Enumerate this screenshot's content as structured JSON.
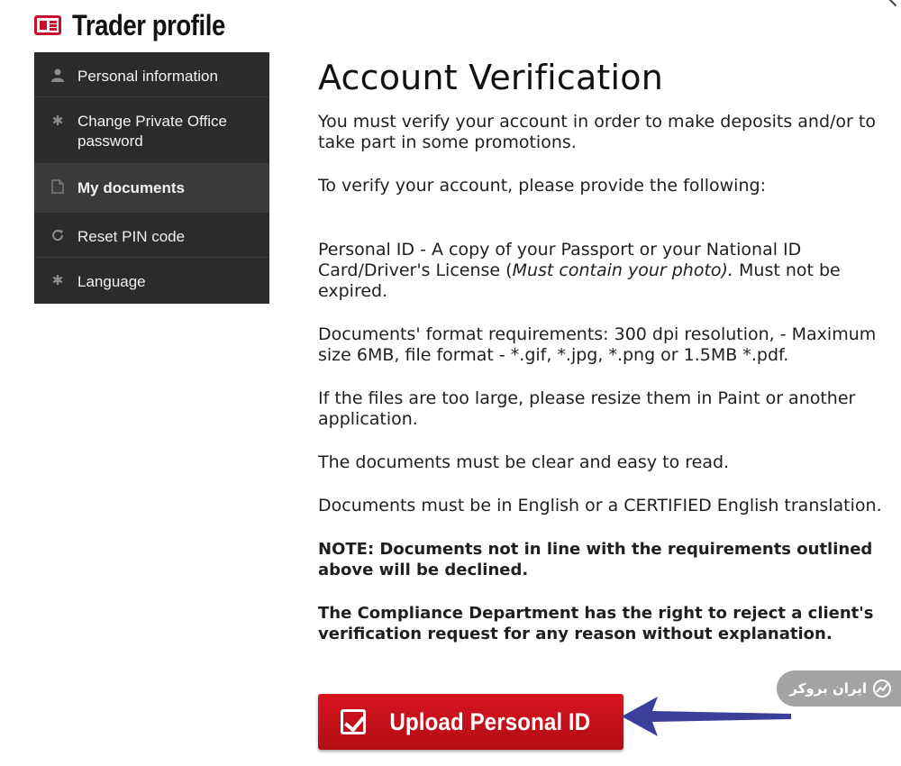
{
  "header": {
    "title": "Trader profile"
  },
  "sidebar": {
    "items": [
      {
        "label": "Personal information",
        "icon": "person-icon"
      },
      {
        "label_line1": "Change Private Office",
        "label_line2": "password",
        "icon": "asterisk-icon"
      },
      {
        "label": "My documents",
        "icon": "document-icon",
        "active": true
      },
      {
        "label": "Reset PIN code",
        "icon": "refresh-icon"
      },
      {
        "label": "Language",
        "icon": "asterisk-icon"
      }
    ]
  },
  "main": {
    "title": "Account Verification",
    "intro": "You must verify your account in order to make deposits and/or to take part in some promotions.",
    "provide": "To verify your account, please provide the following:",
    "personal_id_a": "Personal ID - A copy of your Passport or your National ID Card/Driver's License (",
    "personal_id_em": "Must contain your photo).",
    "personal_id_b": " Must not be expired.",
    "format": "Documents' format requirements: 300 dpi resolution, - Maximum size 6MB, file format - *.gif, *.jpg, *.png or 1.5MB *.pdf.",
    "large": "If the files are too large, please resize them in Paint or another application.",
    "clear": "The documents must be clear and easy to read.",
    "english": "Documents must be in English or a CERTIFIED English translation.",
    "note": "NOTE: Documents not in line with the requirements outlined above will be declined.",
    "compliance": "The Compliance Department has the right to reject a client's verification request for any reason without explanation."
  },
  "upload_button": {
    "label": "Upload Personal ID"
  },
  "watermark": {
    "text": "ایران بروکر"
  },
  "colors": {
    "brand_red": "#c8102e",
    "sidebar_bg": "#2b2b2b",
    "arrow_blue": "#3a3f9a"
  }
}
